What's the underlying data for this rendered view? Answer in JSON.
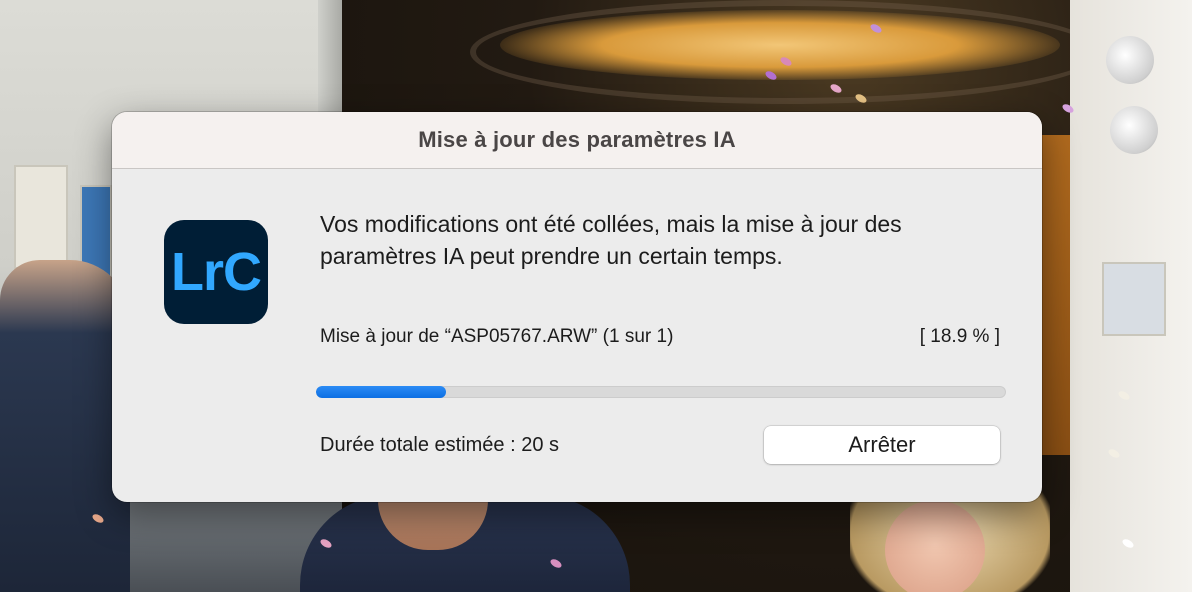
{
  "dialog": {
    "title": "Mise à jour des paramètres IA",
    "app_icon": {
      "name": "lightroom-classic-icon",
      "text": "LrC",
      "bg_color": "#001e36",
      "text_color": "#31a8ff"
    },
    "message": "Vos modifications ont été collées, mais la mise à jour des paramètres IA peut prendre un certain temps.",
    "progress": {
      "label": "Mise à jour de “ASP05767.ARW” (1 sur 1)",
      "percent_text": "[ 18.9 % ]",
      "fraction": 0.189,
      "color": "#0c6fe3"
    },
    "eta": "Durée totale estimée : 20 s",
    "stop_button_label": "Arrêter"
  }
}
